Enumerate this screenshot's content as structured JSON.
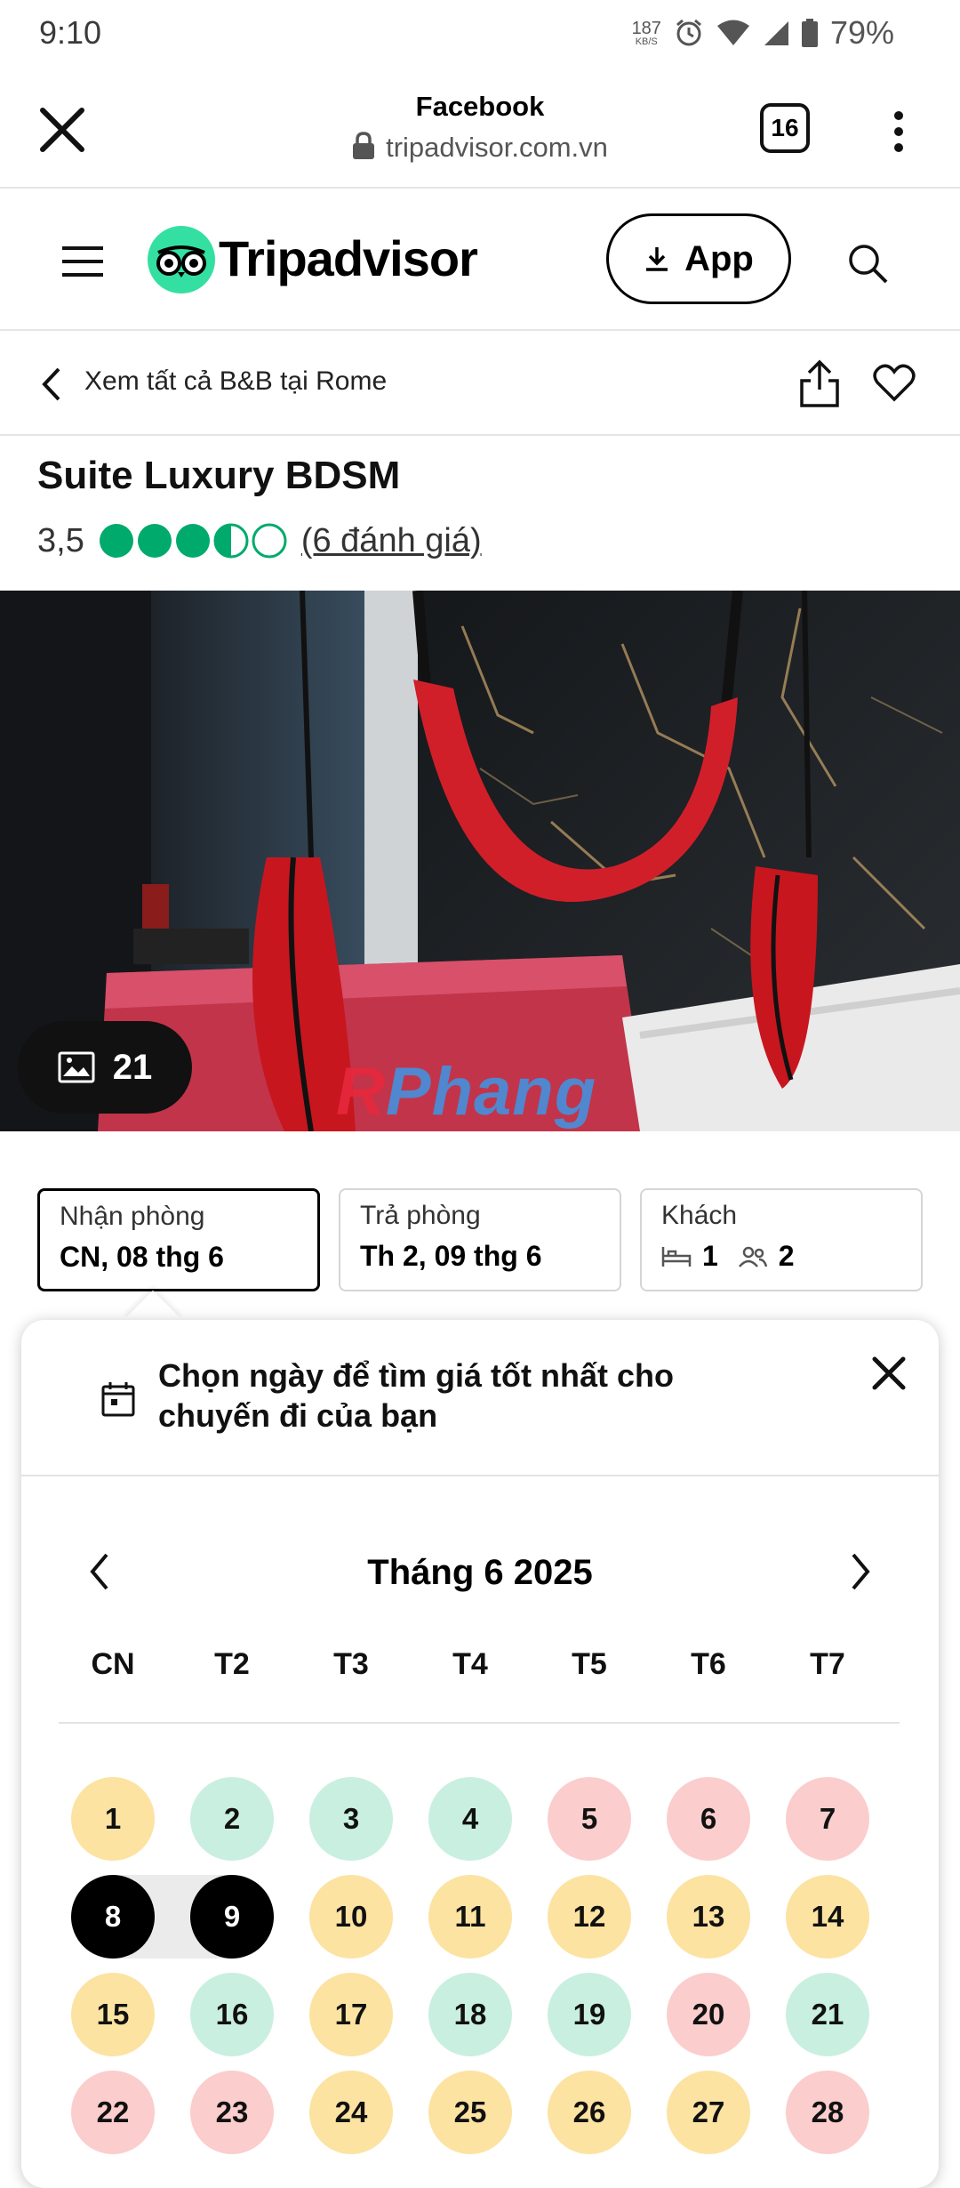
{
  "status_bar": {
    "time": "9:10",
    "speed_value": "187",
    "speed_unit": "KB/S",
    "battery": "79%",
    "icons": [
      "alarm-icon",
      "wifi-icon",
      "signal-icon",
      "battery-icon"
    ]
  },
  "browser": {
    "title": "Facebook",
    "url": "tripadvisor.com.vn",
    "tab_count": "16"
  },
  "header": {
    "brand": "Tripadvisor",
    "app_label": "App",
    "brand_color": "#34e0a1"
  },
  "nav": {
    "back_label": "Xem tất cả B&B tại Rome"
  },
  "listing": {
    "title": "Suite Luxury BDSM",
    "rating_value": "3,5",
    "rating_bubbles": 3.5,
    "reviews_label": "(6 đánh giá)",
    "photo_count": "21",
    "photo_watermark": "Phang",
    "photo_watermark_first": "R"
  },
  "booking": {
    "checkin_label": "Nhận phòng",
    "checkin_value": "CN, 08 thg 6",
    "checkout_label": "Trả phòng",
    "checkout_value": "Th 2, 09 thg 6",
    "guests_label": "Khách",
    "rooms_count": "1",
    "guests_count": "2"
  },
  "calendar": {
    "message": "Chọn ngày để tìm giá tốt nhất cho chuyến đi của bạn",
    "month_label": "Tháng 6 2025",
    "weekdays": [
      "CN",
      "T2",
      "T3",
      "T4",
      "T5",
      "T6",
      "T7"
    ],
    "days": [
      {
        "d": "1",
        "c": "yellow"
      },
      {
        "d": "2",
        "c": "green"
      },
      {
        "d": "3",
        "c": "green"
      },
      {
        "d": "4",
        "c": "green"
      },
      {
        "d": "5",
        "c": "red"
      },
      {
        "d": "6",
        "c": "red"
      },
      {
        "d": "7",
        "c": "red"
      },
      {
        "d": "8",
        "c": "sel"
      },
      {
        "d": "9",
        "c": "sel"
      },
      {
        "d": "10",
        "c": "yellow"
      },
      {
        "d": "11",
        "c": "yellow"
      },
      {
        "d": "12",
        "c": "yellow"
      },
      {
        "d": "13",
        "c": "yellow"
      },
      {
        "d": "14",
        "c": "yellow"
      },
      {
        "d": "15",
        "c": "yellow"
      },
      {
        "d": "16",
        "c": "green"
      },
      {
        "d": "17",
        "c": "yellow"
      },
      {
        "d": "18",
        "c": "green"
      },
      {
        "d": "19",
        "c": "green"
      },
      {
        "d": "20",
        "c": "red"
      },
      {
        "d": "21",
        "c": "green"
      },
      {
        "d": "22",
        "c": "red"
      },
      {
        "d": "23",
        "c": "red"
      },
      {
        "d": "24",
        "c": "yellow"
      },
      {
        "d": "25",
        "c": "yellow"
      },
      {
        "d": "26",
        "c": "yellow"
      },
      {
        "d": "27",
        "c": "yellow"
      },
      {
        "d": "28",
        "c": "red"
      }
    ],
    "colors": {
      "yellow": "#fce3a1",
      "green": "#c9efe0",
      "red": "#fbcdcd",
      "selected": "#000000"
    }
  }
}
